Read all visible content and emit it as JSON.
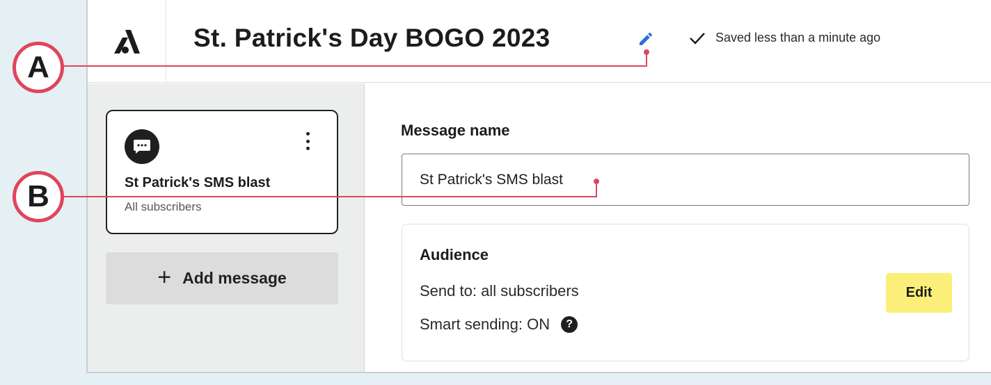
{
  "header": {
    "campaign_title": "St. Patrick's Day BOGO 2023",
    "saved_status": "Saved less than a minute ago"
  },
  "sidebar": {
    "message_card": {
      "name": "St Patrick's SMS blast",
      "audience": "All subscribers"
    },
    "add_message_plus": "+",
    "add_message_label": "Add message"
  },
  "main": {
    "message_name_label": "Message name",
    "message_name_value": "St Patrick's SMS blast",
    "audience": {
      "title": "Audience",
      "send_to": "Send to: all subscribers",
      "smart_sending": "Smart sending: ON",
      "help_glyph": "?",
      "edit_label": "Edit"
    }
  },
  "annotations": {
    "a_label": "A",
    "b_label": "B"
  },
  "colors": {
    "background": "#e5f0f4",
    "callout": "#e0455c",
    "edit_button": "#fbef7a",
    "pencil": "#2f6fd6"
  },
  "icons": [
    "brand-logo-icon",
    "pencil-icon",
    "check-icon",
    "chat-bubble-icon",
    "more-vertical-icon",
    "plus-icon",
    "help-icon"
  ]
}
